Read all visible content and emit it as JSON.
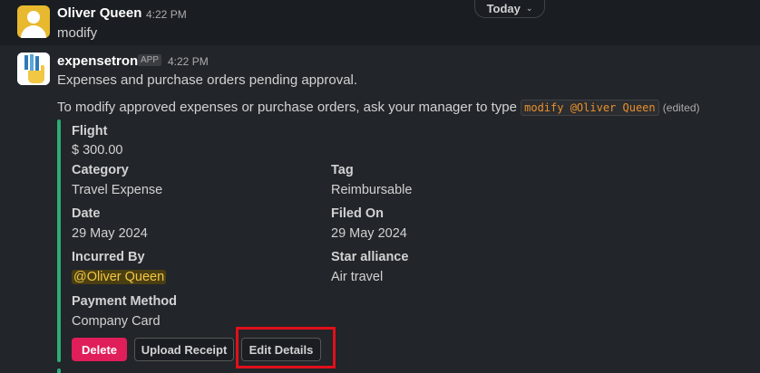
{
  "date_divider": {
    "label": "Today"
  },
  "message_user": {
    "sender": "Oliver Queen",
    "time": "4:22 PM",
    "text": "modify"
  },
  "message_bot": {
    "sender": "expensetron",
    "badge": "APP",
    "time": "4:22 PM",
    "line1": "Expenses and purchase orders pending approval.",
    "line2_prefix": "To modify approved expenses or purchase orders, ask your manager to type",
    "line2_code": "modify @Oliver Queen",
    "edited": "(edited)"
  },
  "attachment": {
    "accent_color": "#2bac76",
    "title": "Flight",
    "amount": "$ 300.00",
    "fields": {
      "category": {
        "label": "Category",
        "value": "Travel Expense"
      },
      "tag": {
        "label": "Tag",
        "value": "Reimbursable"
      },
      "date": {
        "label": "Date",
        "value": "29 May 2024"
      },
      "filed_on": {
        "label": "Filed On",
        "value": "29 May 2024"
      },
      "incurred_by": {
        "label": "Incurred By",
        "value": "@Oliver Queen"
      },
      "star_alliance": {
        "label": "Star alliance",
        "value": "Air travel"
      },
      "payment_method": {
        "label": "Payment Method",
        "value": "Company Card"
      }
    },
    "buttons": {
      "delete": "Delete",
      "upload_receipt": "Upload Receipt",
      "edit_details": "Edit Details"
    }
  },
  "icons": {
    "user_avatar": "person-avatar-icon",
    "bot_avatar": "expensetron-logo-icon",
    "chevron": "chevron-down-icon"
  }
}
